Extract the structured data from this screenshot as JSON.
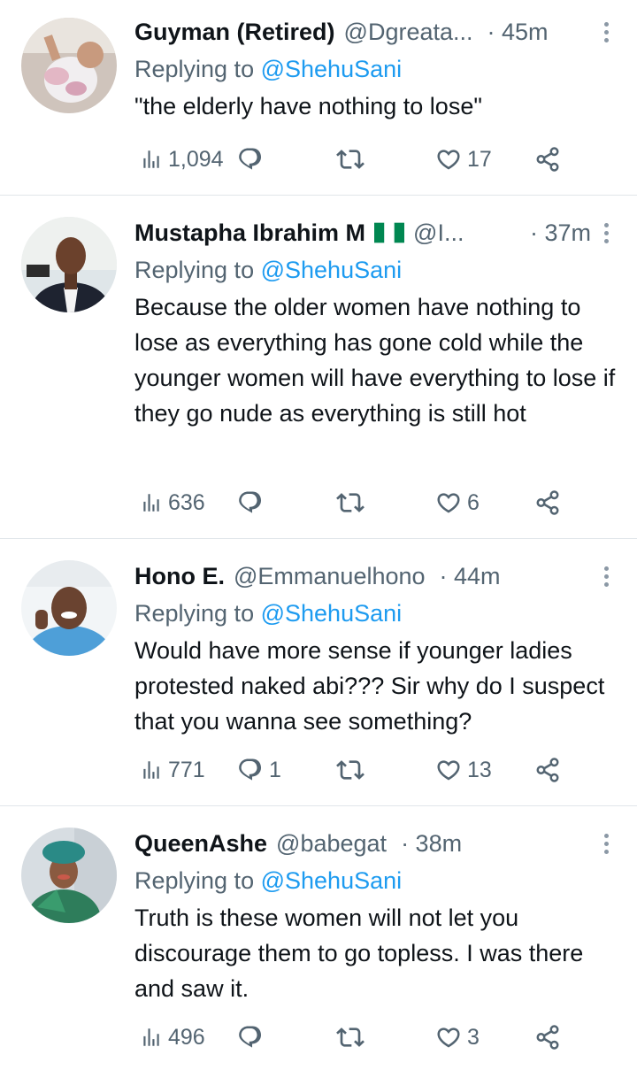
{
  "replies": [
    {
      "name": "Guyman (Retired)",
      "handle": "@Dgreata...",
      "time": "· 45m",
      "replying_label": "Replying to",
      "replying_to": "@ShehuSani",
      "text": "\"the elderly have nothing to lose\"",
      "views": "1,094",
      "replies": "",
      "retweets": "",
      "likes": "17"
    },
    {
      "name": "Mustapha Ibrahim M",
      "handle": "@I...",
      "time": "· 37m",
      "replying_label": "Replying to",
      "replying_to": "@ShehuSani",
      "text": "Because the older women have nothing to lose as everything has gone cold while the younger women will have everything to lose if they go nude as everything is still hot",
      "views": "636",
      "replies": "",
      "retweets": "",
      "likes": "6"
    },
    {
      "name": "Hono E.",
      "handle": "@Emmanuelhono",
      "time": "· 44m",
      "replying_label": "Replying to",
      "replying_to": "@ShehuSani",
      "text": "Would have more sense if younger ladies protested naked abi??? Sir why do I suspect that you wanna see something?",
      "views": "771",
      "replies": "1",
      "retweets": "",
      "likes": "13"
    },
    {
      "name": "QueenAshe",
      "handle": "@babegat",
      "time": "· 38m",
      "replying_label": "Replying to",
      "replying_to": "@ShehuSani",
      "text": "Truth is these women will not let you discourage them to go topless. I was there and saw it.",
      "views": "496",
      "replies": "",
      "retweets": "",
      "likes": "3"
    }
  ],
  "colors": {
    "link": "#1d9bf0",
    "secondary": "#536471",
    "divider": "#e1e6ea",
    "flag_green": "#008751"
  },
  "icons": [
    "views-icon",
    "reply-icon",
    "retweet-icon",
    "like-icon",
    "share-icon",
    "more-icon",
    "nigeria-flag-icon"
  ]
}
